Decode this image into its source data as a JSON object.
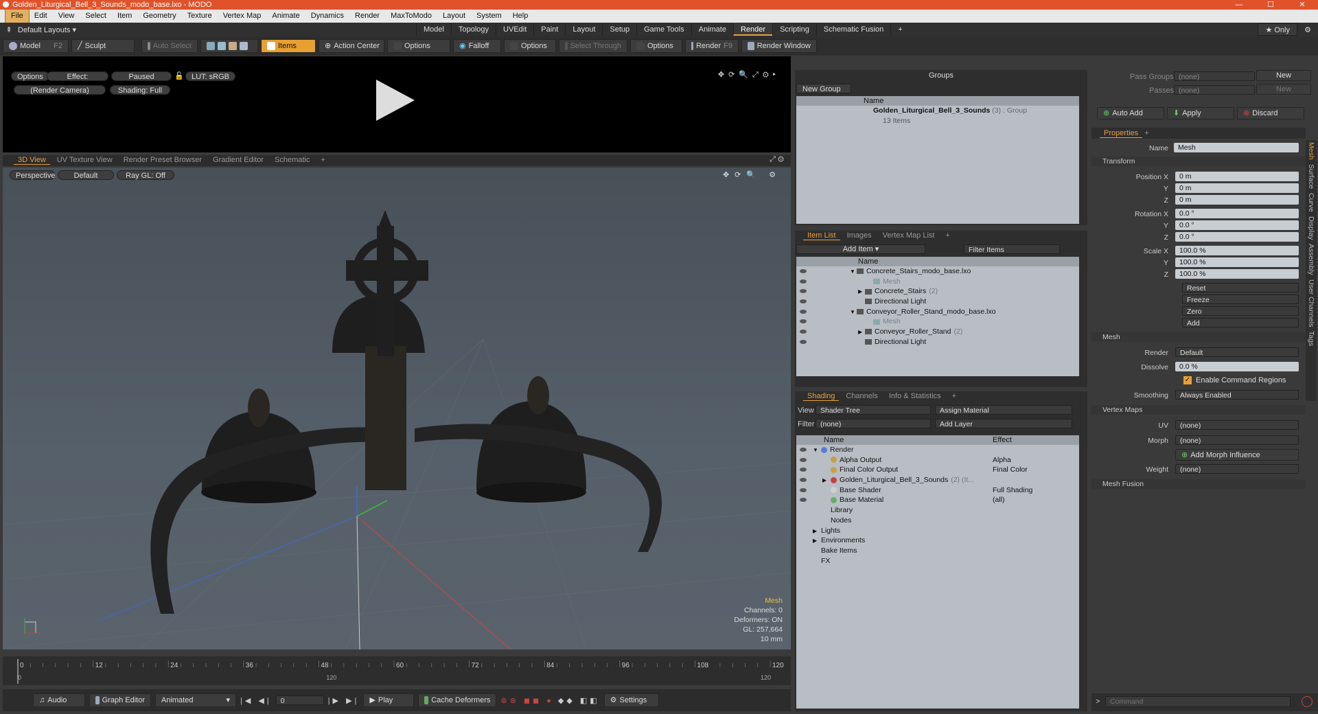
{
  "window": {
    "title": "Golden_Liturgical_Bell_3_Sounds_modo_base.lxo - MODO",
    "minimize": "—",
    "maximize": "☐",
    "close": "✕"
  },
  "menu": [
    "File",
    "Edit",
    "View",
    "Select",
    "Item",
    "Geometry",
    "Texture",
    "Vertex Map",
    "Animate",
    "Dynamics",
    "Render",
    "MaxToModo",
    "Layout",
    "System",
    "Help"
  ],
  "layout_selector": "Default Layouts ▾",
  "layout_tabs": [
    "Model",
    "Topology",
    "UVEdit",
    "Paint",
    "Layout",
    "Setup",
    "Game Tools",
    "Animate",
    "Render",
    "Scripting",
    "Schematic Fusion",
    "+"
  ],
  "active_layout_tab": "Render",
  "only_label": "★  Only",
  "toolbar": {
    "model": "Model",
    "model_key": "F2",
    "sculpt": "Sculpt",
    "auto_select": "Auto Select",
    "items": "Items",
    "action_center": "Action Center",
    "options1": "Options",
    "falloff": "Falloff",
    "options2": "Options",
    "select_through": "Select Through",
    "options3": "Options",
    "render": "Render",
    "render_key": "F9",
    "render_window": "Render Window"
  },
  "render_view": {
    "options": "Options",
    "effect": "Effect: (Shadi...",
    "paused": "Paused",
    "lut": "LUT: sRGB",
    "camera": "(Render Camera)",
    "shading": "Shading: Full"
  },
  "view_tabs": [
    "3D View",
    "UV Texture View",
    "Render Preset Browser",
    "Gradient Editor",
    "Schematic",
    "+"
  ],
  "viewport": {
    "perspective": "Perspective",
    "default": "Default",
    "raygl": "Ray GL: Off",
    "info": [
      "Mesh",
      "Channels: 0",
      "Deformers: ON",
      "GL: 257,664",
      "10 mm"
    ]
  },
  "timeline": {
    "ticks": [
      "0",
      "12",
      "24",
      "36",
      "48",
      "60",
      "72",
      "84",
      "96",
      "108",
      "120"
    ],
    "sub_ticks": [
      "0",
      "120",
      "120"
    ]
  },
  "bottom": {
    "audio": "Audio",
    "graph_editor": "Graph Editor",
    "animated": "Animated",
    "frame": "0",
    "play": "Play",
    "cache_deformers": "Cache Deformers",
    "settings": "Settings"
  },
  "groups": {
    "header": "Groups",
    "new_group": "New Group",
    "col_name": "Name",
    "item_name": "Golden_Liturgical_Bell_3_Sounds",
    "item_suffix": "(3) : Group",
    "item_sub": "13 Items"
  },
  "item_list": {
    "tabs": [
      "Item List",
      "Images",
      "Vertex Map List",
      "+"
    ],
    "add_item": "Add Item",
    "filter_items": "Filter Items",
    "col_name": "Name",
    "rows": [
      {
        "label": "Concrete_Stairs_modo_base.lxo",
        "indent": 0,
        "arrow": "▼",
        "count": "",
        "dim": false
      },
      {
        "label": "Mesh",
        "indent": 2,
        "arrow": "",
        "count": "",
        "dim": true
      },
      {
        "label": "Concrete_Stairs",
        "indent": 1,
        "arrow": "▶",
        "count": "(2)",
        "dim": false
      },
      {
        "label": "Directional Light",
        "indent": 1,
        "arrow": "",
        "count": "",
        "dim": false
      },
      {
        "label": "Conveyor_Roller_Stand_modo_base.lxo",
        "indent": 0,
        "arrow": "▼",
        "count": "",
        "dim": false
      },
      {
        "label": "Mesh",
        "indent": 2,
        "arrow": "",
        "count": "",
        "dim": true
      },
      {
        "label": "Conveyor_Roller_Stand",
        "indent": 1,
        "arrow": "▶",
        "count": "(2)",
        "dim": false
      },
      {
        "label": "Directional Light",
        "indent": 1,
        "arrow": "",
        "count": "",
        "dim": false
      }
    ]
  },
  "shading": {
    "tabs": [
      "Shading",
      "Channels",
      "Info & Statistics",
      "+"
    ],
    "view_label": "View",
    "view_value": "Shader Tree",
    "assign_material": "Assign Material",
    "filter_label": "Filter",
    "filter_value": "(none)",
    "add_layer": "Add Layer",
    "col_name": "Name",
    "col_effect": "Effect",
    "rows": [
      {
        "label": "Render",
        "effect": "",
        "indent": 0,
        "arrow": "▼",
        "color": "#5a7ad8"
      },
      {
        "label": "Alpha Output",
        "effect": "Alpha",
        "indent": 1,
        "arrow": "",
        "color": "#c8a040"
      },
      {
        "label": "Final Color Output",
        "effect": "Final Color",
        "indent": 1,
        "arrow": "",
        "color": "#c8a040"
      },
      {
        "label": "Golden_Liturgical_Bell_3_Sounds",
        "effect": "",
        "indent": 1,
        "arrow": "▶",
        "color": "#c84040",
        "suffix": "(2) (It..."
      },
      {
        "label": "Base Shader",
        "effect": "Full Shading",
        "indent": 1,
        "arrow": "",
        "color": "#d0d0d0"
      },
      {
        "label": "Base Material",
        "effect": "(all)",
        "indent": 1,
        "arrow": "",
        "color": "#60b060"
      },
      {
        "label": "Library",
        "effect": "",
        "indent": 1,
        "arrow": "",
        "color": ""
      },
      {
        "label": "Nodes",
        "effect": "",
        "indent": 1,
        "arrow": "",
        "color": ""
      },
      {
        "label": "Lights",
        "effect": "",
        "indent": 0,
        "arrow": "▶",
        "color": ""
      },
      {
        "label": "Environments",
        "effect": "",
        "indent": 0,
        "arrow": "▶",
        "color": ""
      },
      {
        "label": "Bake Items",
        "effect": "",
        "indent": 0,
        "arrow": "",
        "color": ""
      },
      {
        "label": "FX",
        "effect": "",
        "indent": 0,
        "arrow": "",
        "color": ""
      }
    ]
  },
  "passes": {
    "pass_groups": "Pass Groups",
    "passes": "Passes",
    "none": "(none)",
    "new": "New",
    "auto_add": "Auto Add",
    "apply": "Apply",
    "discard": "Discard"
  },
  "properties": {
    "tab": "Properties",
    "name_label": "Name",
    "name_value": "Mesh",
    "transform": "Transform",
    "position_label": "Position X",
    "pos": [
      "0 m",
      "0 m",
      "0 m"
    ],
    "rotation_label": "Rotation X",
    "rot": [
      "0.0 °",
      "0.0 °",
      "0.0 °"
    ],
    "scale_label": "Scale X",
    "scale": [
      "100.0 %",
      "100.0 %",
      "100.0 %"
    ],
    "y": "Y",
    "z": "Z",
    "reset": "Reset",
    "freeze": "Freeze",
    "zero": "Zero",
    "add": "Add",
    "mesh": "Mesh",
    "render_label": "Render",
    "render_value": "Default",
    "dissolve_label": "Dissolve",
    "dissolve_value": "0.0 %",
    "enable_cmd": "Enable Command Regions",
    "smoothing_label": "Smoothing",
    "smoothing_value": "Always Enabled",
    "vertex_maps": "Vertex Maps",
    "uv_label": "UV",
    "uv_value": "(none)",
    "morph_label": "Morph",
    "morph_value": "(none)",
    "add_morph": "Add Morph Influence",
    "weight_label": "Weight",
    "weight_value": "(none)",
    "mesh_fusion": "Mesh Fusion",
    "side_tabs": [
      "Mesh",
      "Surface",
      "Curve",
      "Display",
      "Assembly",
      "User Channels",
      "Tags"
    ]
  },
  "command": {
    "placeholder": "Command"
  }
}
